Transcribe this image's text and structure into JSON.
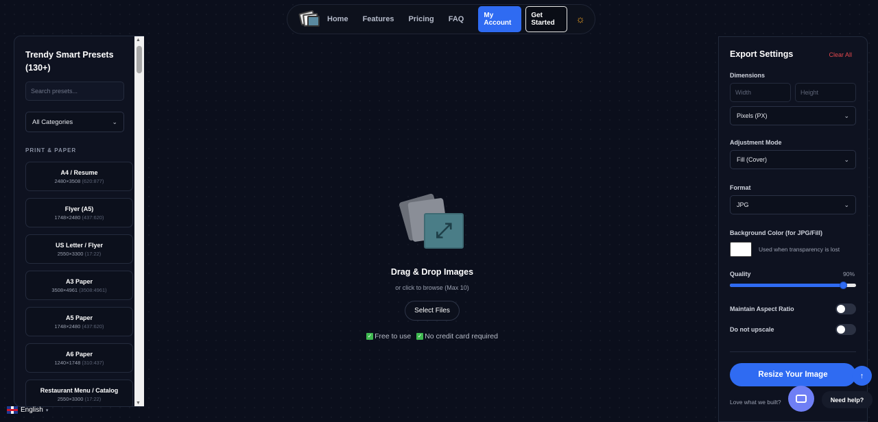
{
  "nav": {
    "links": [
      "Home",
      "Features",
      "Pricing",
      "FAQ"
    ],
    "account_label": "My Account",
    "start_label": "Get Started",
    "theme_icon": "☼"
  },
  "presets_panel": {
    "title_line1": "Trendy Smart Presets",
    "title_line2": "(130+)",
    "search_placeholder": "Search presets...",
    "category_selected": "All Categories",
    "section_title": "PRINT & PAPER",
    "items": [
      {
        "name": "A4 / Resume",
        "size": "2480×3508",
        "ratio": "(620:877)"
      },
      {
        "name": "Flyer (A5)",
        "size": "1748×2480",
        "ratio": "(437:620)"
      },
      {
        "name": "US Letter / Flyer",
        "size": "2550×3300",
        "ratio": "(17:22)"
      },
      {
        "name": "A3 Paper",
        "size": "3508×4961",
        "ratio": "(3508:4961)"
      },
      {
        "name": "A5 Paper",
        "size": "1748×2480",
        "ratio": "(437:620)"
      },
      {
        "name": "A6 Paper",
        "size": "1240×1748",
        "ratio": "(310:437)"
      },
      {
        "name": "Restaurant Menu / Catalog",
        "size": "2550×3300",
        "ratio": "(17:22)"
      }
    ]
  },
  "dropzone": {
    "title": "Drag & Drop Images",
    "subtitle": "or click to browse (Max 10)",
    "button": "Select Files",
    "check1": "Free to use",
    "check2": "No credit card required"
  },
  "export": {
    "title": "Export Settings",
    "clear_label": "Clear All",
    "dimensions_label": "Dimensions",
    "width_placeholder": "Width",
    "height_placeholder": "Height",
    "unit_selected": "Pixels (PX)",
    "mode_label": "Adjustment Mode",
    "mode_selected": "Fill (Cover)",
    "format_label": "Format",
    "format_selected": "JPG",
    "bg_label": "Background Color (for JPG/Fill)",
    "bg_hint": "Used when transparency is lost",
    "bg_color": "#ffffff",
    "quality_label": "Quality",
    "quality_value": "90%",
    "quality_fraction": 0.9,
    "aspect_label": "Maintain Aspect Ratio",
    "upscale_label": "Do not upscale",
    "resize_button": "Resize Your Image",
    "love_text": "Love what we built?"
  },
  "floating": {
    "back_top": "↑",
    "need_help": "Need help?",
    "language": "English"
  },
  "colors": {
    "accent": "#2f6bf2",
    "danger": "#e5484d",
    "success": "#3fb950",
    "background": "#0b0f1c"
  }
}
